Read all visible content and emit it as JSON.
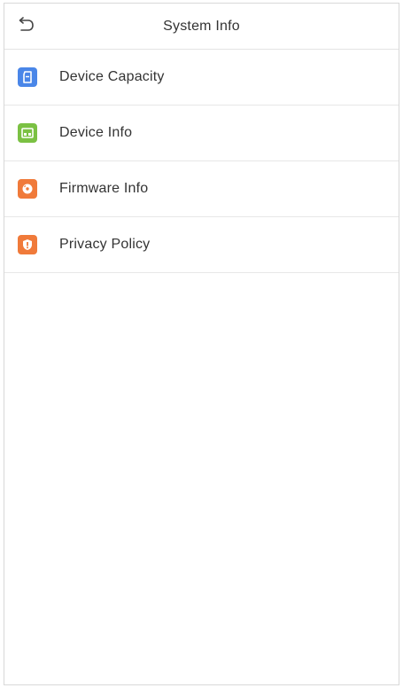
{
  "header": {
    "title": "System Info",
    "back_icon": "back-arrow-icon"
  },
  "menu": {
    "items": [
      {
        "label": "Device Capacity",
        "icon": "sd-card-icon",
        "color": "#4a86e8"
      },
      {
        "label": "Device Info",
        "icon": "device-icon",
        "color": "#7bc143"
      },
      {
        "label": "Firmware Info",
        "icon": "disc-icon",
        "color": "#f07a3a"
      },
      {
        "label": "Privacy Policy",
        "icon": "shield-icon",
        "color": "#f07a3a"
      }
    ]
  }
}
